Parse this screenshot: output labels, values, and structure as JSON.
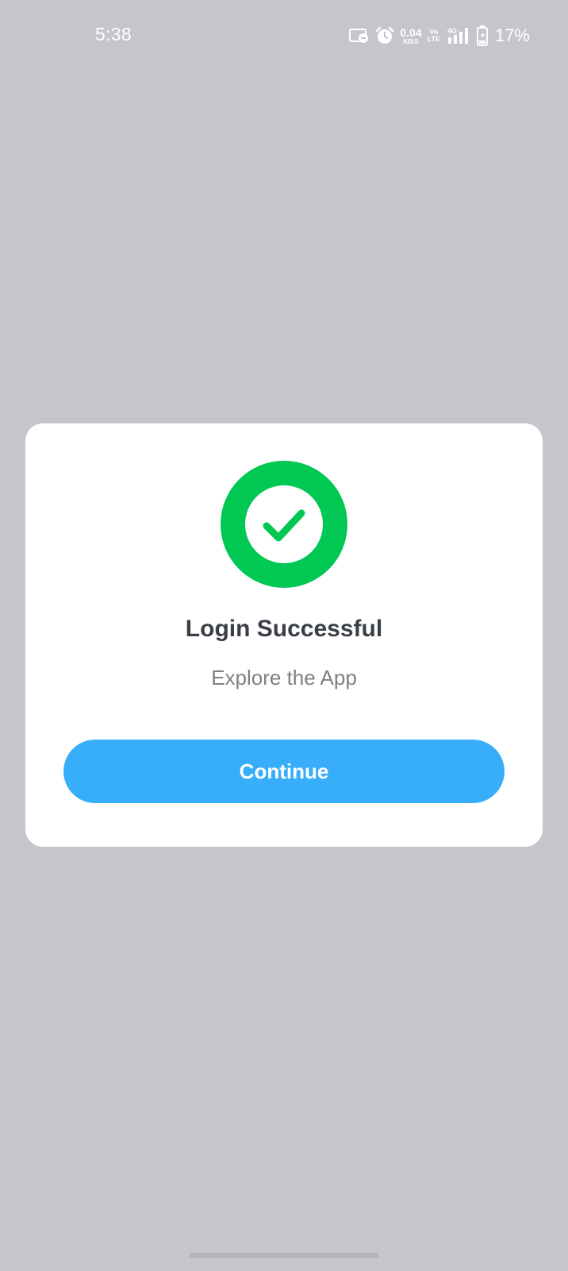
{
  "status_bar": {
    "time": "5:38",
    "network_speed_value": "0.04",
    "network_speed_unit": "KB/S",
    "volte_top": "Vo",
    "volte_bottom": "LTE",
    "signal_label": "4G",
    "battery_percent": "17%",
    "icons": [
      "cast-icon",
      "alarm-icon",
      "signal-icon",
      "battery-charging-icon"
    ]
  },
  "dialog": {
    "icon": "check-circle-icon",
    "title": "Login Successful",
    "subtitle": "Explore the App",
    "continue_label": "Continue"
  },
  "colors": {
    "background_overlay": "#c5c6cb",
    "success_green": "#00c853",
    "button_blue": "#38aefb",
    "title_text": "#3a3f47",
    "subtitle_text": "#808080"
  }
}
